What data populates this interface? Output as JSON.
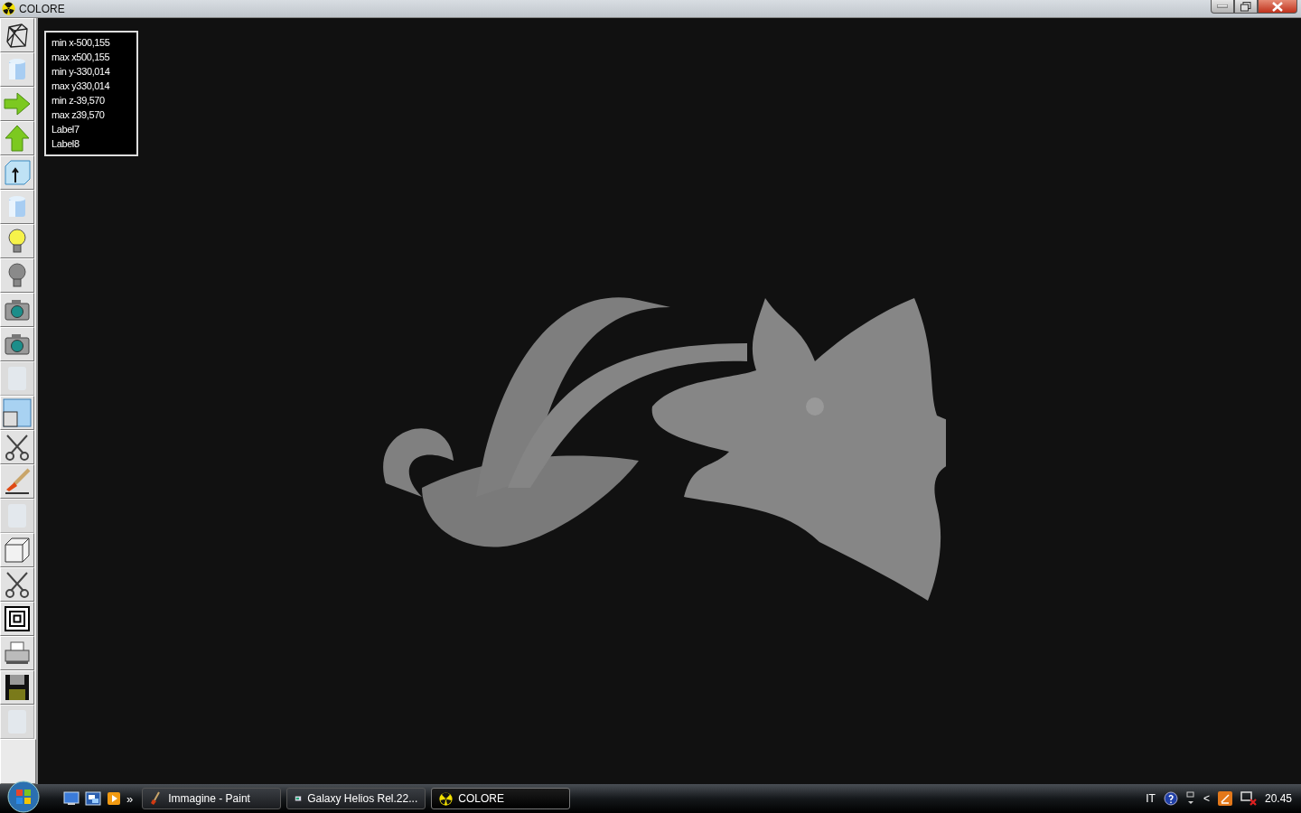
{
  "window": {
    "title": "COLORE"
  },
  "toolbar": [
    {
      "kind": "wireframe",
      "disabled": false
    },
    {
      "kind": "cylinder",
      "disabled": false
    },
    {
      "kind": "arrow-right",
      "disabled": false
    },
    {
      "kind": "arrow-up",
      "disabled": false
    },
    {
      "kind": "box-up",
      "disabled": false
    },
    {
      "kind": "cylinder",
      "disabled": false
    },
    {
      "kind": "bulb-on",
      "disabled": false
    },
    {
      "kind": "bulb-off",
      "disabled": false
    },
    {
      "kind": "camera",
      "disabled": false
    },
    {
      "kind": "camera",
      "disabled": false
    },
    {
      "kind": "blank",
      "disabled": true
    },
    {
      "kind": "panes",
      "disabled": false
    },
    {
      "kind": "scissors",
      "disabled": false
    },
    {
      "kind": "brush",
      "disabled": false
    },
    {
      "kind": "blank",
      "disabled": true
    },
    {
      "kind": "cube",
      "disabled": false
    },
    {
      "kind": "scissors",
      "disabled": false
    },
    {
      "kind": "squares",
      "disabled": false
    },
    {
      "kind": "printer",
      "disabled": false
    },
    {
      "kind": "floppy",
      "disabled": false
    },
    {
      "kind": "blank",
      "disabled": true
    }
  ],
  "info_labels": [
    "min x-500,155",
    "max x500,155",
    "min y-330,014",
    "max y330,014",
    "min z-39,570",
    "max z39,570",
    "Label7",
    "Label8"
  ],
  "taskbar": {
    "overflow": "»",
    "tasks": [
      {
        "kind": "paint",
        "label": "Immagine - Paint",
        "selected": false
      },
      {
        "kind": "galaxy",
        "label": "Galaxy Helios  Rel.22...",
        "selected": false
      },
      {
        "kind": "colore",
        "label": "COLORE",
        "selected": true
      }
    ],
    "language": "IT",
    "tray_chevron": "<",
    "clock": "20.45"
  }
}
